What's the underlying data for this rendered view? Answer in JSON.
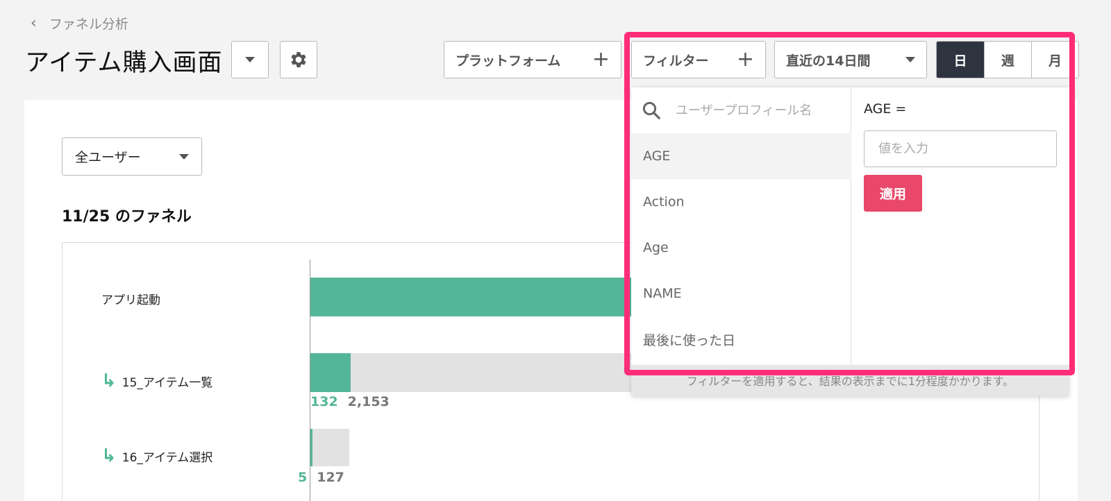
{
  "header": {
    "breadcrumb": "ファネル分析",
    "title": "アイテム購入画面",
    "platform_button": "プラットフォーム",
    "filter_button": "フィルター",
    "date_range": "直近の14日間",
    "period_tabs": [
      "日",
      "週",
      "月"
    ],
    "active_period": "日"
  },
  "main": {
    "user_segment": "全ユーザー",
    "funnel_heading": "11/25 のファネル"
  },
  "chart_data": {
    "type": "bar",
    "orientation": "horizontal",
    "categories": [
      "アプリ起動",
      "15_アイテム一覧",
      "16_アイテム選択"
    ],
    "steps": [
      {
        "label": "アプリ起動",
        "converted": null,
        "total": null,
        "converted_label": "",
        "total_label": ""
      },
      {
        "label": "15_アイテム一覧",
        "converted": 132,
        "total": 2153,
        "converted_label": "132",
        "total_label": "2,153"
      },
      {
        "label": "16_アイテム選択",
        "converted": 5,
        "total": 127,
        "converted_label": "5",
        "total_label": "127"
      }
    ]
  },
  "filter_dropdown": {
    "search_placeholder": "ユーザープロフィール名",
    "properties": [
      "AGE",
      "Action",
      "Age",
      "NAME",
      "最後に使った日"
    ],
    "selected_property": "AGE",
    "condition_label": "AGE =",
    "value_placeholder": "値を入力",
    "apply_label": "適用",
    "footer_note": "フィルターを適用すると、結果の表示までに1分程度かかります。"
  },
  "colors": {
    "bar_fill": "#54b699",
    "bar_track": "#e2e2e2",
    "apply_button": "#e9486a",
    "active_tab": "#2e3340",
    "highlight": "#ff2d78"
  }
}
